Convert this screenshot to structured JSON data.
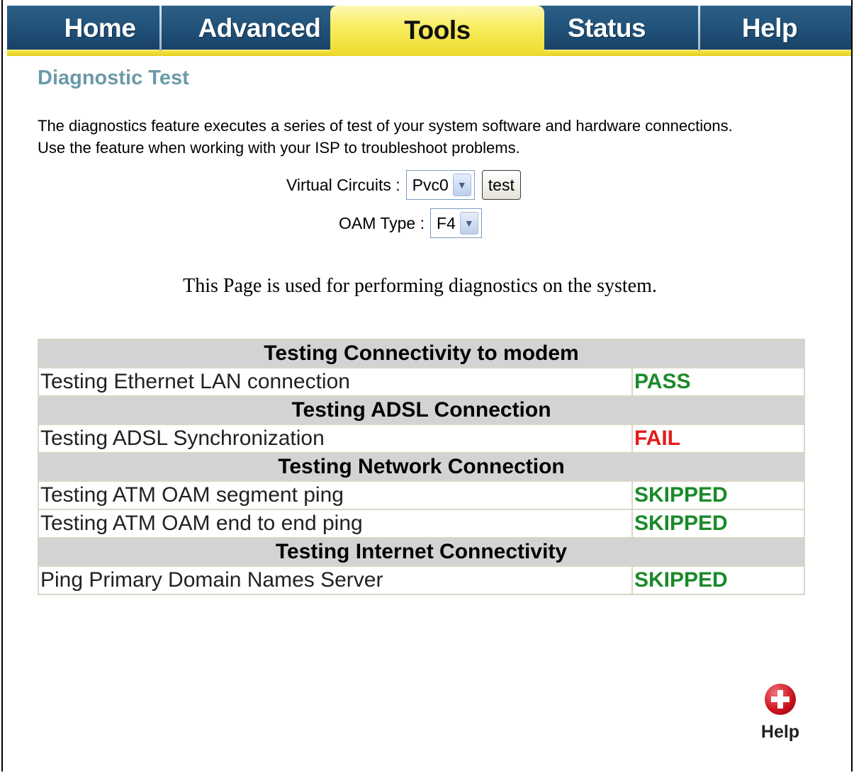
{
  "nav": {
    "tabs": [
      {
        "label": "Home"
      },
      {
        "label": "Advanced"
      },
      {
        "label": "Tools"
      },
      {
        "label": "Status"
      },
      {
        "label": "Help"
      }
    ],
    "active_tab": "Tools"
  },
  "page": {
    "title": "Diagnostic Test",
    "description": "The diagnostics feature executes a series of test of your system software and hardware connections. Use the feature when working with your ISP to troubleshoot problems.",
    "info_text": "This Page is used for performing diagnostics on the system."
  },
  "controls": {
    "virtual_circuits_label": "Virtual Circuits :",
    "virtual_circuits_value": "Pvc0",
    "test_button": "test",
    "oam_type_label": "OAM Type :",
    "oam_type_value": "F4"
  },
  "results": {
    "sections": [
      {
        "title": "Testing Connectivity to modem",
        "rows": [
          {
            "test": "Testing Ethernet LAN connection",
            "result": "PASS",
            "color": "#1a8a2a"
          }
        ]
      },
      {
        "title": "Testing ADSL Connection",
        "rows": [
          {
            "test": "Testing ADSL Synchronization",
            "result": "FAIL",
            "color": "#e31b1b"
          }
        ]
      },
      {
        "title": "Testing Network Connection",
        "rows": [
          {
            "test": "Testing ATM OAM segment ping",
            "result": "SKIPPED",
            "color": "#1a8a2a"
          },
          {
            "test": "Testing ATM OAM end to end ping",
            "result": "SKIPPED",
            "color": "#1a8a2a"
          }
        ]
      },
      {
        "title": "Testing Internet Connectivity",
        "rows": [
          {
            "test": "Ping Primary Domain Names Server",
            "result": "SKIPPED",
            "color": "#1a8a2a"
          }
        ]
      }
    ]
  },
  "help_widget": {
    "label": "Help",
    "icon": "plus-circle-icon"
  },
  "colors": {
    "nav_blue": "#1f4f77",
    "active_tab_yellow": "#f8ec5d",
    "title_teal": "#6b9aa8",
    "section_gray": "#d3d3d3",
    "pass_green": "#1a8a2a",
    "fail_red": "#e31b1b"
  }
}
